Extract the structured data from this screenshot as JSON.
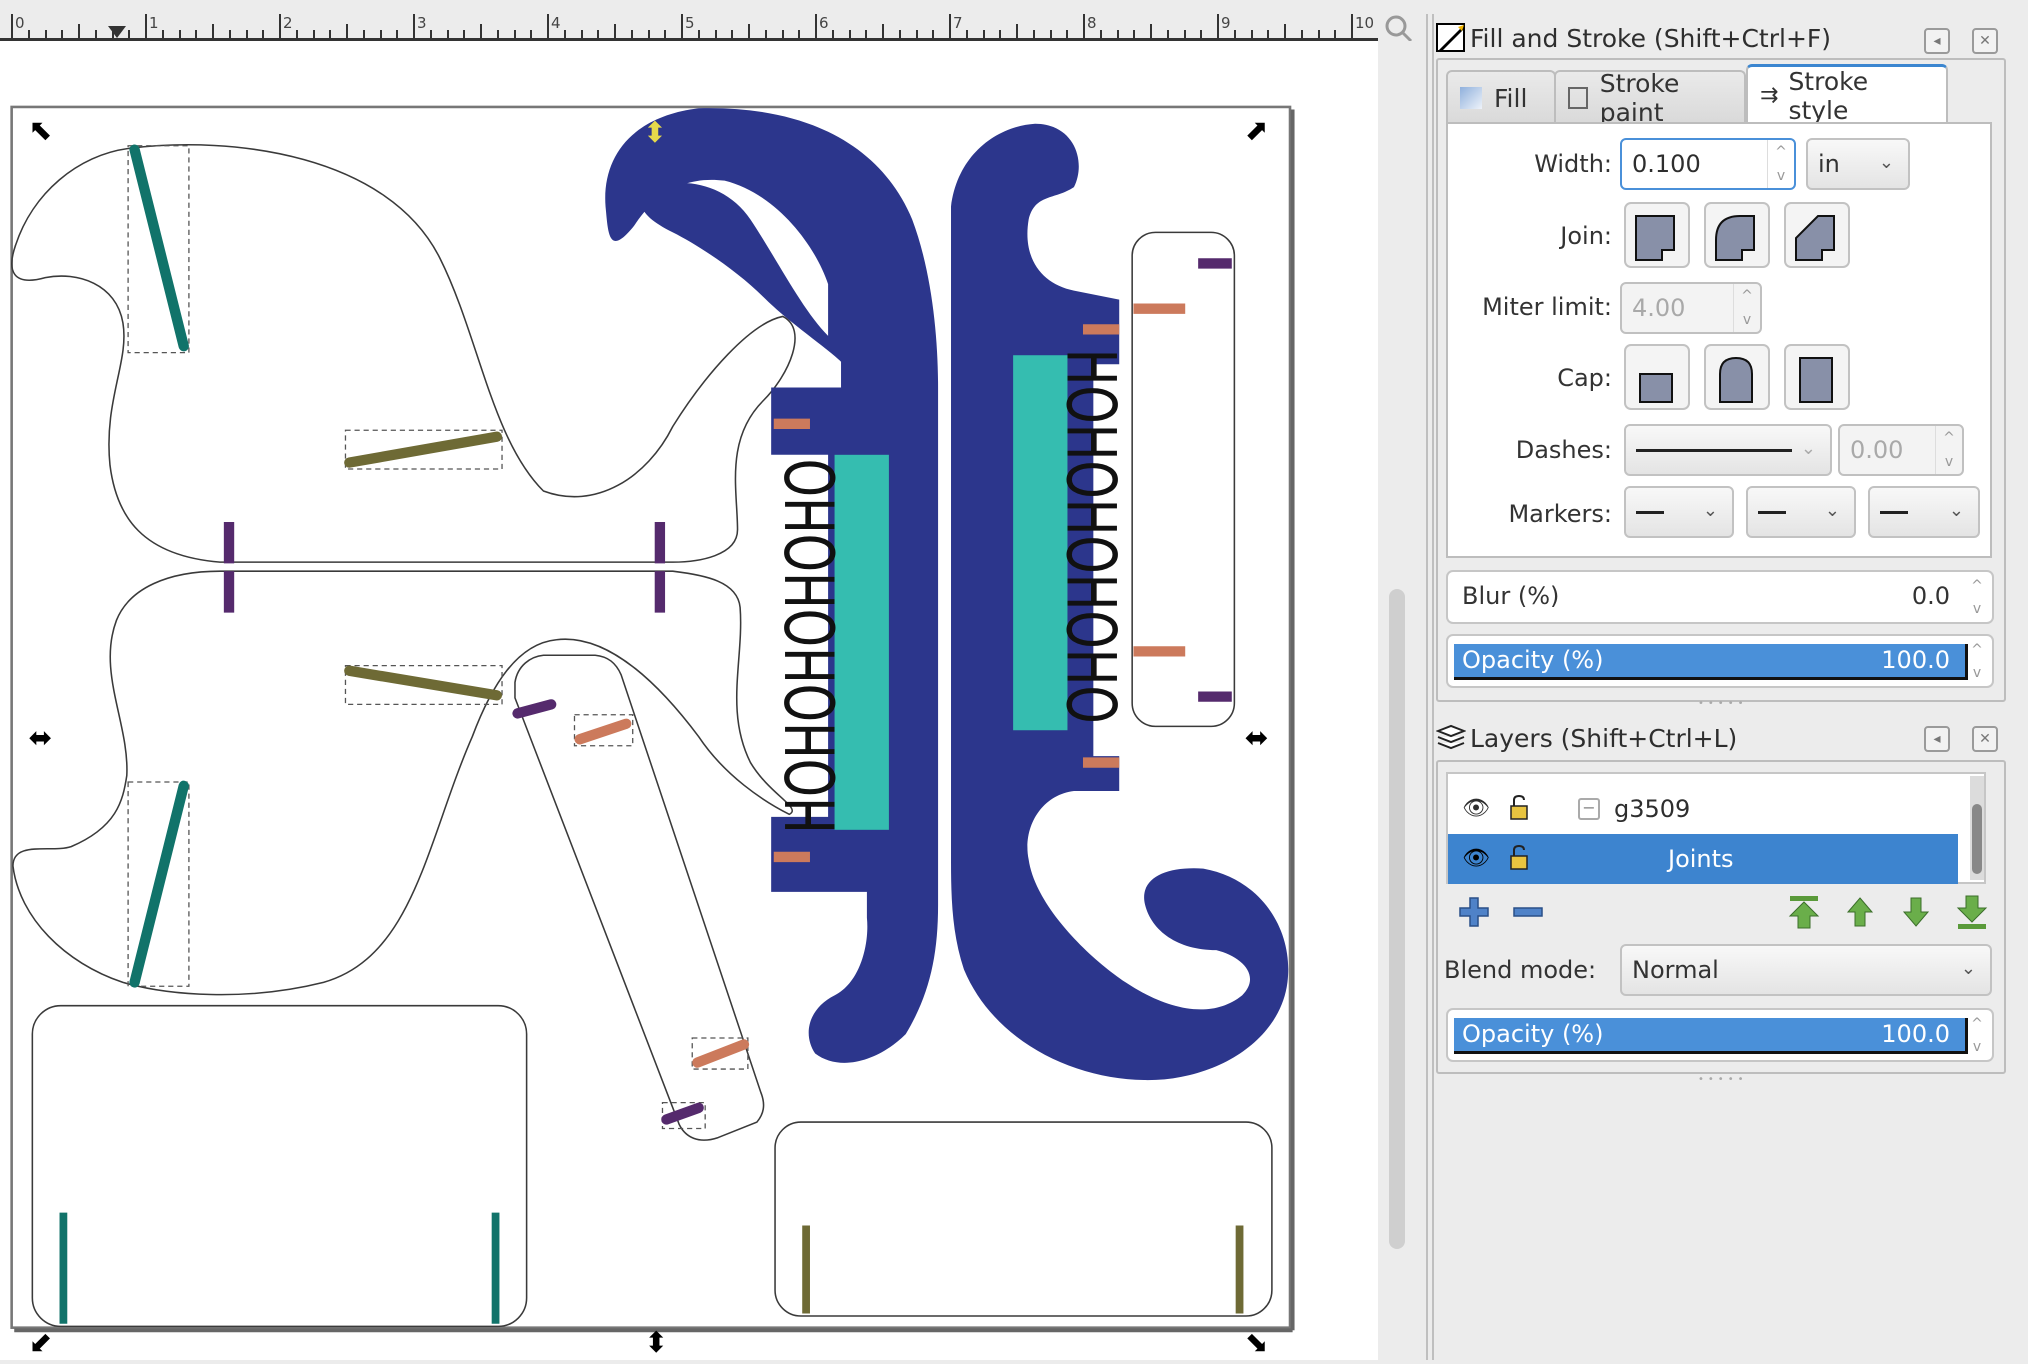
{
  "ruler": {
    "labels": [
      "0",
      "1",
      "2",
      "3",
      "4",
      "5",
      "6",
      "7",
      "8",
      "9",
      "10"
    ]
  },
  "canvas": {
    "shape_text": "HOHOHOHOHO",
    "colors": {
      "navy": "#2c368c",
      "teal_fill": "#35bdb0",
      "teal_joint": "#11736a",
      "olive_joint": "#6e6a35",
      "purple_joint": "#552a6d",
      "salmon_joint": "#cc7a5c",
      "outline": "#3a3a3a"
    }
  },
  "fill_stroke": {
    "title": "Fill and Stroke (Shift+Ctrl+F)",
    "tabs": [
      {
        "label": "Fill",
        "active": false
      },
      {
        "label": "Stroke paint",
        "active": false
      },
      {
        "label": "Stroke style",
        "active": true
      }
    ],
    "width_label": "Width:",
    "width_value": "0.100",
    "width_unit": "in",
    "join_label": "Join:",
    "join_options": [
      "miter-join",
      "round-join",
      "bevel-join"
    ],
    "miter_label": "Miter limit:",
    "miter_value": "4.00",
    "cap_label": "Cap:",
    "cap_options": [
      "butt-cap",
      "round-cap",
      "square-cap"
    ],
    "dashes_label": "Dashes:",
    "dash_offset": "0.00",
    "markers_label": "Markers:",
    "blur_label": "Blur (%)",
    "blur_value": "0.0",
    "opacity_label": "Opacity (%)",
    "opacity_value": "100.0",
    "opacity_fraction": 1.0
  },
  "layers": {
    "title": "Layers (Shift+Ctrl+L)",
    "rows": [
      {
        "name": "g3509",
        "selected": false,
        "expander": "−"
      },
      {
        "name": "Joints",
        "selected": true
      }
    ],
    "blend_label": "Blend mode:",
    "blend_value": "Normal",
    "opacity_label": "Opacity (%)",
    "opacity_value": "100.0",
    "opacity_fraction": 1.0
  }
}
